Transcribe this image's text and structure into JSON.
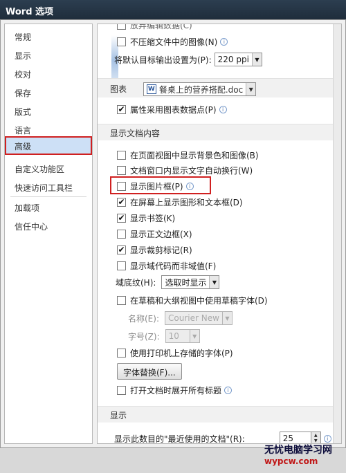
{
  "window": {
    "title": "Word 选项"
  },
  "sidebar": {
    "items": [
      {
        "label": "常规"
      },
      {
        "label": "显示"
      },
      {
        "label": "校对"
      },
      {
        "label": "保存"
      },
      {
        "label": "版式"
      },
      {
        "label": "语言"
      },
      {
        "label": "高级",
        "selected": true
      },
      {
        "label": "自定义功能区"
      },
      {
        "label": "快速访问工具栏"
      },
      {
        "label": "加载项"
      },
      {
        "label": "信任中心"
      }
    ]
  },
  "image_size": {
    "top_cut_option": "放弃编辑数据(C)",
    "no_compress": "不压缩文件中的图像(N)",
    "default_resolution_label": "将默认目标输出设置为(P):",
    "default_resolution_value": "220 ppi"
  },
  "chart": {
    "label": "图表",
    "document_value": "餐桌上的营养搭配.doc",
    "property_follow": "属性采用图表数据点(P)"
  },
  "show_document_content": {
    "header": "显示文档内容",
    "options": [
      {
        "label": "在页面视图中显示背景色和图像(B)",
        "checked": false
      },
      {
        "label": "文档窗口内显示文字自动换行(W)",
        "checked": false
      },
      {
        "label": "显示图片框(P)",
        "checked": false
      },
      {
        "label": "在屏幕上显示图形和文本框(D)",
        "checked": true
      },
      {
        "label": "显示书签(K)",
        "checked": true
      },
      {
        "label": "显示正文边框(X)",
        "checked": false
      },
      {
        "label": "显示裁剪标记(R)",
        "checked": true
      },
      {
        "label": "显示域代码而非域值(F)",
        "checked": false
      }
    ],
    "field_shading_label": "域底纹(H):",
    "field_shading_value": "选取时显示",
    "draft_font_option": "在草稿和大纲视图中使用草稿字体(D)",
    "draft_font_checked": false,
    "name_label": "名称(E):",
    "name_value": "Courier New",
    "size_label": "字号(Z):",
    "size_value": "10",
    "printer_fonts_option": "使用打印机上存储的字体(P)",
    "printer_fonts_checked": false,
    "font_sub_button": "字体替换(F)...",
    "expand_headings_option": "打开文档时展开所有标题",
    "expand_headings_checked": false
  },
  "display": {
    "header": "显示",
    "recent_docs_label": "显示此数目的\"最近使用的文档\"(R):",
    "recent_docs_value": "25"
  },
  "watermark": {
    "line1": "无忧电脑学习网",
    "line2": "wypcw.com"
  }
}
